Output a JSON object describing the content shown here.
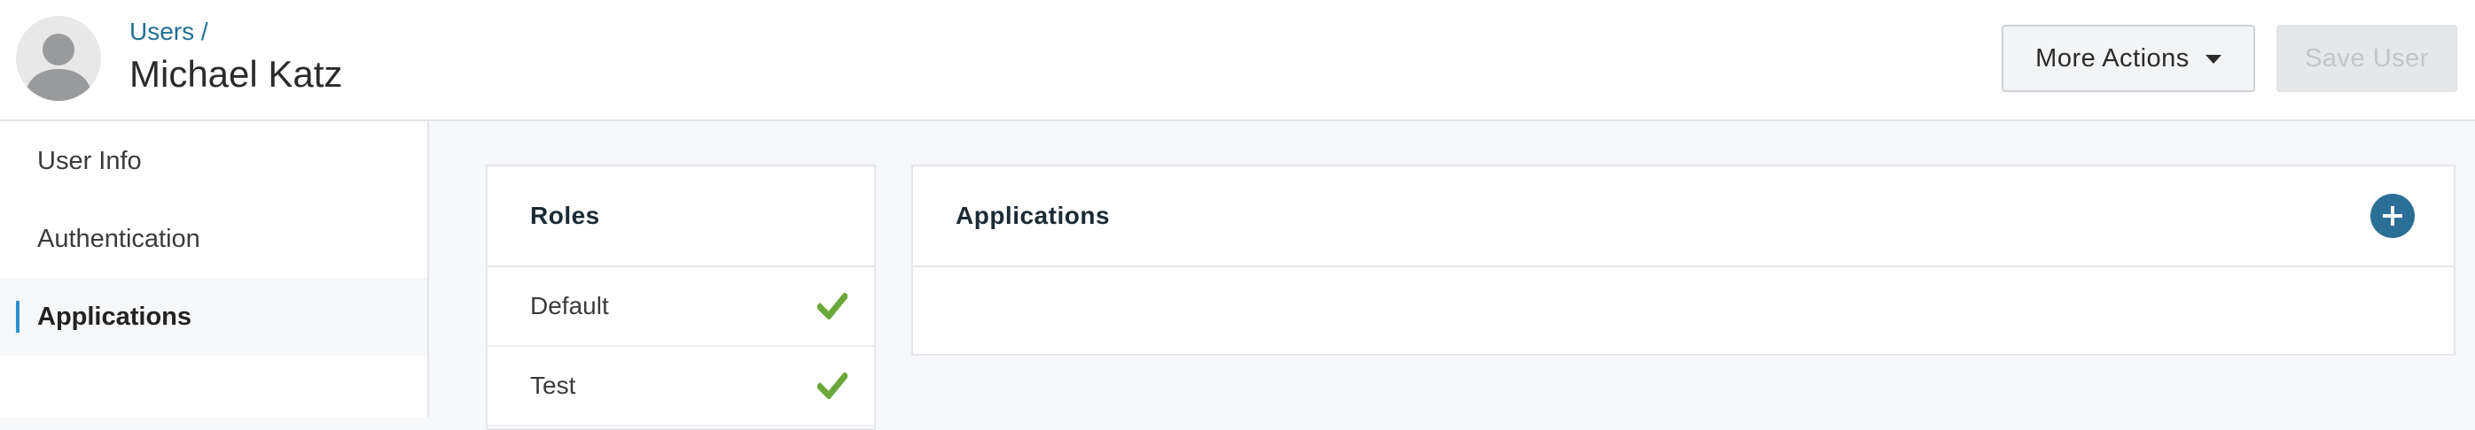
{
  "header": {
    "breadcrumb": "Users /",
    "title": "Michael Katz",
    "more_actions_label": "More Actions",
    "save_label": "Save User"
  },
  "sidebar": {
    "items": [
      {
        "label": "User Info",
        "active": false
      },
      {
        "label": "Authentication",
        "active": false
      },
      {
        "label": "Applications",
        "active": true
      }
    ]
  },
  "roles": {
    "title": "Roles",
    "items": [
      {
        "label": "Default",
        "checked": true
      },
      {
        "label": "Test",
        "checked": true
      }
    ]
  },
  "applications": {
    "title": "Applications"
  },
  "colors": {
    "link": "#1f6f94",
    "accent": "#2a6f96",
    "check": "#6aa83a",
    "active_indicator": "#2b8fd1"
  },
  "icons": {
    "avatar": "user-silhouette-icon",
    "more_actions": "caret-down-icon",
    "role_check": "check-icon",
    "add": "plus-icon"
  }
}
